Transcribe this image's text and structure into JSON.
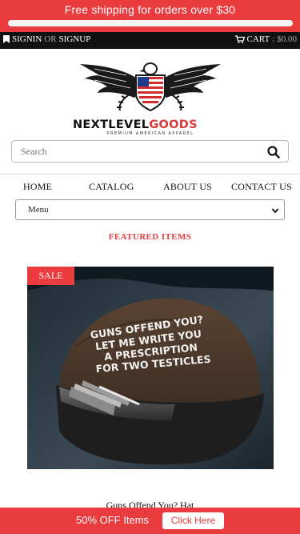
{
  "promo_top": {
    "text": "Free shipping for orders over $30",
    "progress": 0
  },
  "account_bar": {
    "signin": "SIGNIN",
    "or": "OR",
    "signup": "SIGNUP",
    "cart_label": "CART",
    "cart_sep": ":",
    "cart_total": "$0.00"
  },
  "logo": {
    "brand_part1": "NEXTLEVEL",
    "brand_part2": "GOODS",
    "tagline": "PREMIUM AMERICAN APPAREL"
  },
  "search": {
    "placeholder": "Search",
    "value": ""
  },
  "nav": {
    "items": [
      "HOME",
      "CATALOG",
      "ABOUT US",
      "CONTACT US"
    ]
  },
  "menu_select": {
    "selected": "Menu"
  },
  "featured": {
    "heading": "FEATURED ITEMS"
  },
  "product": {
    "badge": "SALE",
    "hat_text": [
      "GUNS OFFEND YOU?",
      "LET ME WRITE YOU",
      "A PRESCRIPTION",
      "FOR TWO TESTICLES"
    ],
    "title": "Guns Offend You? Hat"
  },
  "promo_bottom": {
    "text": "50% OFF Items",
    "cta": "Click Here"
  },
  "colors": {
    "accent": "#ea3b3e",
    "topbar": "#111111"
  },
  "icons": [
    "bookmark-icon",
    "cart-icon",
    "search-icon",
    "chevron-down-icon"
  ]
}
